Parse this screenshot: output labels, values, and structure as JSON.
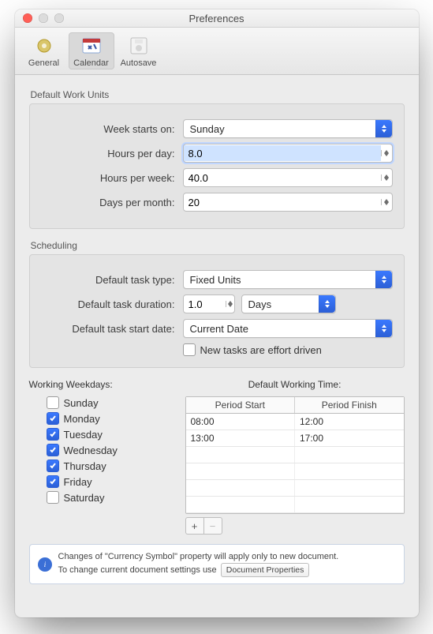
{
  "window": {
    "title": "Preferences"
  },
  "toolbar": {
    "general": "General",
    "calendar": "Calendar",
    "autosave": "Autosave",
    "active": "calendar"
  },
  "sections": {
    "workUnitsTitle": "Default Work Units",
    "schedulingTitle": "Scheduling",
    "weekdaysTitle": "Working Weekdays:",
    "workingTimeTitle": "Default Working Time:"
  },
  "labels": {
    "weekStarts": "Week starts on:",
    "hoursPerDay": "Hours per day:",
    "hoursPerWeek": "Hours per week:",
    "daysPerMonth": "Days per month:",
    "defaultTaskType": "Default task type:",
    "defaultTaskDuration": "Default task duration:",
    "defaultTaskStartDate": "Default task start date:",
    "effortDriven": "New tasks are effort driven"
  },
  "values": {
    "weekStarts": "Sunday",
    "hoursPerDay": "8.0",
    "hoursPerWeek": "40.0",
    "daysPerMonth": "20",
    "taskType": "Fixed Units",
    "taskDurationValue": "1.0",
    "taskDurationUnit": "Days",
    "taskStartDate": "Current Date",
    "effortDrivenChecked": false
  },
  "weekdays": [
    {
      "name": "Sunday",
      "checked": false
    },
    {
      "name": "Monday",
      "checked": true
    },
    {
      "name": "Tuesday",
      "checked": true
    },
    {
      "name": "Wednesday",
      "checked": true
    },
    {
      "name": "Thursday",
      "checked": true
    },
    {
      "name": "Friday",
      "checked": true
    },
    {
      "name": "Saturday",
      "checked": false
    }
  ],
  "workingTime": {
    "headers": {
      "start": "Period Start",
      "finish": "Period Finish"
    },
    "rows": [
      {
        "start": "08:00",
        "finish": "12:00"
      },
      {
        "start": "13:00",
        "finish": "17:00"
      },
      {
        "start": "",
        "finish": ""
      },
      {
        "start": "",
        "finish": ""
      },
      {
        "start": "",
        "finish": ""
      },
      {
        "start": "",
        "finish": ""
      }
    ]
  },
  "info": {
    "line1": "Changes of \"Currency Symbol\" property will apply only to new document.",
    "line2": "To change current document settings use",
    "button": "Document Properties"
  }
}
